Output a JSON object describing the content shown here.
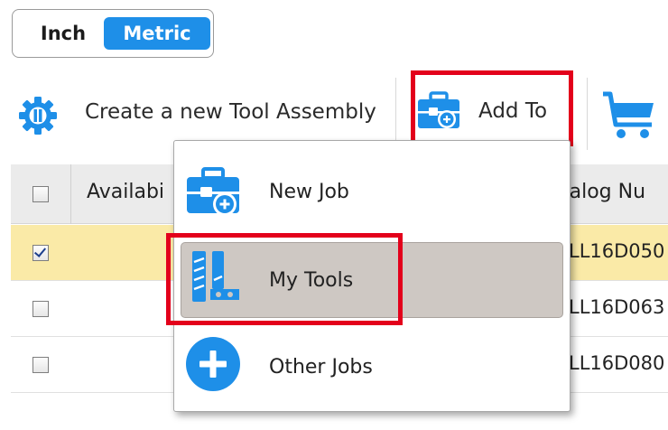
{
  "units": {
    "inch_label": "Inch",
    "metric_label": "Metric",
    "selected": "Metric"
  },
  "toolbar": {
    "create_label": "Create a new Tool Assembly",
    "add_to_label": "Add To"
  },
  "table": {
    "columns": {
      "availability": "Availabi",
      "catalog": "talog Nu"
    },
    "rows": [
      {
        "checked": true,
        "catalog": "LL16D050"
      },
      {
        "checked": false,
        "catalog": "LL16D063"
      },
      {
        "checked": false,
        "catalog": "LL16D080"
      }
    ]
  },
  "add_to_menu": {
    "items": [
      {
        "label": "New Job",
        "icon": "briefcase-plus-icon"
      },
      {
        "label": "My Tools",
        "icon": "end-mill-tools-icon",
        "active": true
      },
      {
        "label": "Other Jobs",
        "icon": "plus-circle-icon"
      }
    ]
  },
  "colors": {
    "accent_blue": "#1e8fe8",
    "highlight_red": "#e3001b",
    "selected_row": "#faeaa7",
    "menu_active": "#cec8c3"
  }
}
